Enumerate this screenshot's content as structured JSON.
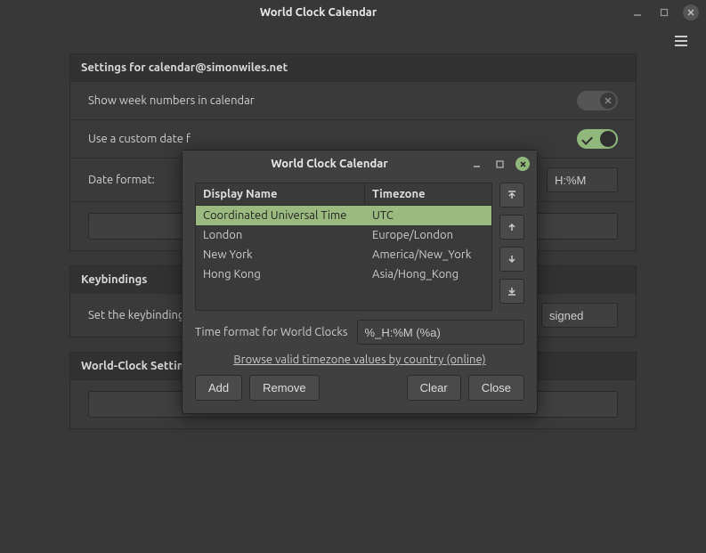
{
  "main_window": {
    "title": "World Clock Calendar"
  },
  "settings": {
    "header": "Settings for calendar@simonwiles.net",
    "show_week_label": "Show week numbers in calendar",
    "custom_date_label": "Use a custom date f",
    "date_format_label": "Date format:",
    "date_format_value_tail": "H:%M"
  },
  "keybindings": {
    "header": "Keybindings",
    "row_label": "Set the keybinding",
    "value_tail": "signed"
  },
  "world_clock_section": {
    "header": "World-Clock Settings"
  },
  "dialog": {
    "title": "World Clock Calendar",
    "columns": {
      "display_name": "Display Name",
      "timezone": "Timezone"
    },
    "rows": [
      {
        "name": "Coordinated Universal Time",
        "tz": "UTC",
        "selected": true
      },
      {
        "name": "London",
        "tz": "Europe/London",
        "selected": false
      },
      {
        "name": "New York",
        "tz": "America/New_York",
        "selected": false
      },
      {
        "name": "Hong Kong",
        "tz": "Asia/Hong_Kong",
        "selected": false
      }
    ],
    "time_format_label": "Time format for World Clocks",
    "time_format_value": "%_H:%M (%a)",
    "browse_link": "Browse valid timezone values by country (online)",
    "buttons": {
      "add": "Add",
      "remove": "Remove",
      "clear": "Clear",
      "close": "Close"
    }
  }
}
